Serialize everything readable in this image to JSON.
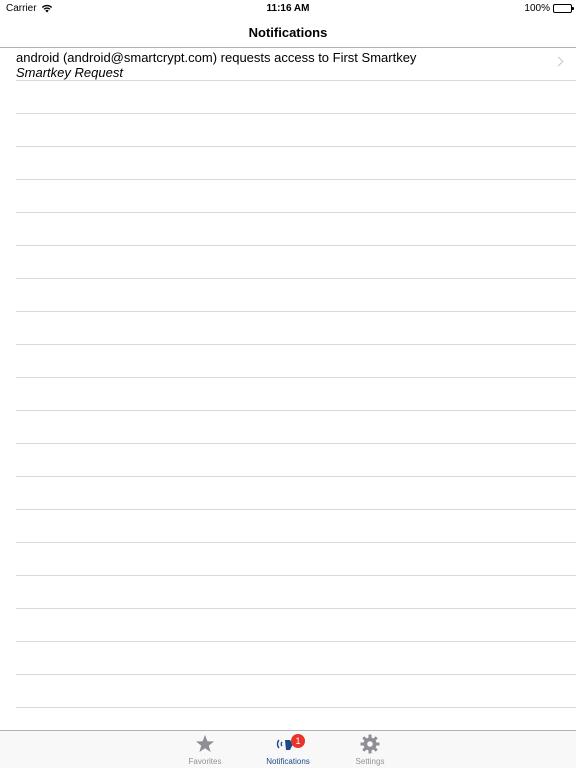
{
  "status_bar": {
    "carrier": "Carrier",
    "time": "11:16 AM",
    "battery": "100%"
  },
  "nav": {
    "title": "Notifications"
  },
  "notifications": [
    {
      "title": "android (android@smartcrypt.com) requests access to First Smartkey",
      "subtitle": "Smartkey Request"
    }
  ],
  "tabs": [
    {
      "label": "Favorites",
      "icon": "star-icon",
      "active": false
    },
    {
      "label": "Notifications",
      "icon": "notification-signal-icon",
      "active": true,
      "badge": "1"
    },
    {
      "label": "Settings",
      "icon": "gear-icon",
      "active": false
    }
  ],
  "colors": {
    "accent": "#1c4a88",
    "badge": "#e8342a",
    "inactive_tab": "#929292",
    "separator": "#d9d9d9"
  }
}
